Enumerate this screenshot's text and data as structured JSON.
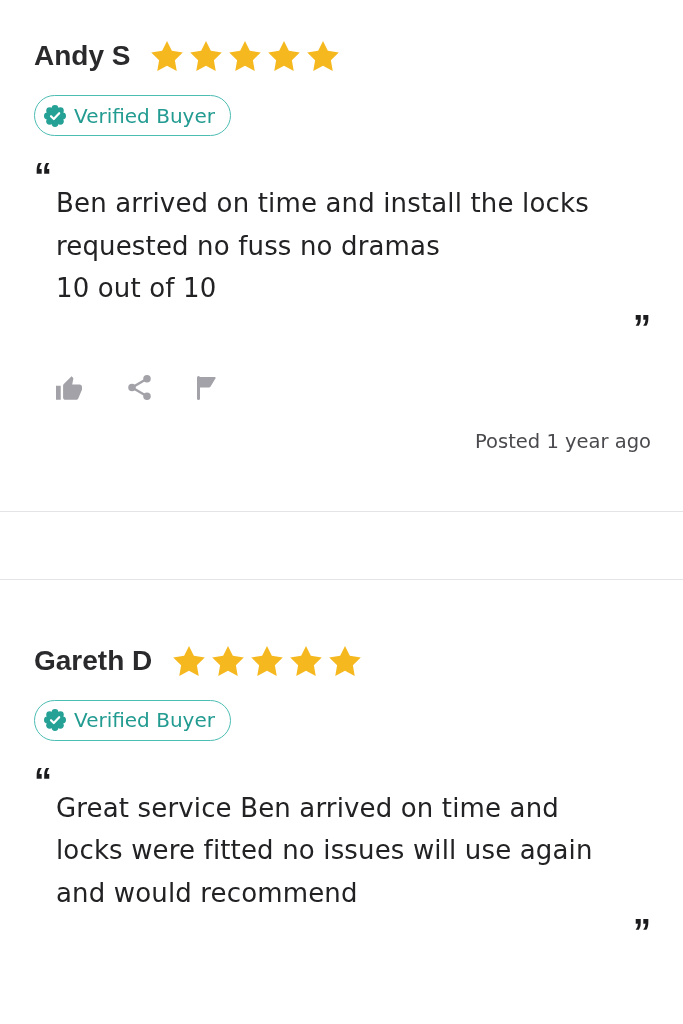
{
  "reviews": [
    {
      "author": "Andy S",
      "stars": 5,
      "badge": "Verified Buyer",
      "open_quote": "“",
      "text": "Ben arrived on time and install the locks\nrequested no fuss no dramas\n10 out of 10",
      "close_quote": "”",
      "actions_bar": true,
      "posted": "Posted 1 year ago"
    },
    {
      "author": "Gareth D",
      "stars": 5,
      "badge": "Verified Buyer",
      "open_quote": "“",
      "text": "Great service Ben arrived on time and\nlocks were fitted no issues will use again\nand would recommend",
      "close_quote": "”"
    }
  ]
}
